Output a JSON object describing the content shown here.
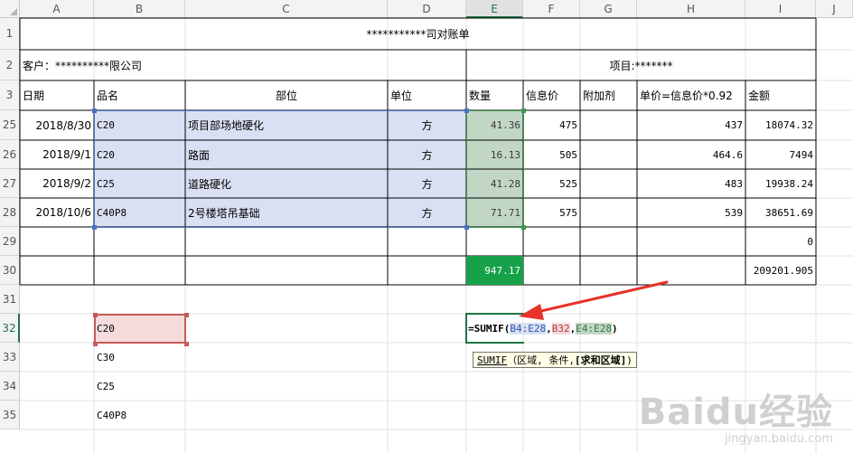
{
  "columns": [
    "A",
    "B",
    "C",
    "D",
    "E",
    "F",
    "G",
    "H",
    "I",
    "J"
  ],
  "selected_column": "E",
  "rows": [
    "1",
    "2",
    "3",
    "25",
    "26",
    "27",
    "28",
    "29",
    "30",
    "31",
    "32",
    "33",
    "34",
    "35"
  ],
  "selected_row": "32",
  "title": "***********司对账单",
  "customer": "客户：**********限公司",
  "project": "项目:*******",
  "headers": [
    "日期",
    "品名",
    "部位",
    "单位",
    "数量",
    "信息价",
    "附加剂",
    "单价=信息价*0.92",
    "金额"
  ],
  "data_rows": [
    {
      "date": "2018/8/30",
      "product": "C20",
      "location": "项目部场地硬化",
      "unit": "方",
      "qty": "41.36",
      "price": "475",
      "additive": "",
      "unit_price": "437",
      "amount": "18074.32"
    },
    {
      "date": "2018/9/1",
      "product": "C20",
      "location": "路面",
      "unit": "方",
      "qty": "16.13",
      "price": "505",
      "additive": "",
      "unit_price": "464.6",
      "amount": "7494"
    },
    {
      "date": "2018/9/2",
      "product": "C25",
      "location": "道路硬化",
      "unit": "方",
      "qty": "41.28",
      "price": "525",
      "additive": "",
      "unit_price": "483",
      "amount": "19938.24"
    },
    {
      "date": "2018/10/6",
      "product": "C40P8",
      "location": "2号楼塔吊基础",
      "unit": "方",
      "qty": "71.71",
      "price": "575",
      "additive": "",
      "unit_price": "539",
      "amount": "38651.69"
    }
  ],
  "row29_amount": "0",
  "row30_qty_total": "947.17",
  "row30_amount_total": "209201.905",
  "criteria_list": [
    "C20",
    "C30",
    "C25",
    "C40P8"
  ],
  "formula": {
    "prefix": "=SUMIF(",
    "range_ref": "B4:E28",
    "sep1": ",",
    "criteria_ref": "B32",
    "sep2": ",",
    "sum_ref": "E4:E28",
    "suffix": ")"
  },
  "tooltip": {
    "func": "SUMIF",
    "args": "（区域, 条件, ",
    "optional": "[求和区域]",
    "close": ")"
  },
  "watermark": {
    "logo": "Baidu经验",
    "url": "jingyan.baidu.com"
  },
  "colors": {
    "blue_range": "#dae0f3",
    "green_range": "#c2d6c6",
    "sum_cell": "#17a24a",
    "arrow": "#e8322a"
  }
}
